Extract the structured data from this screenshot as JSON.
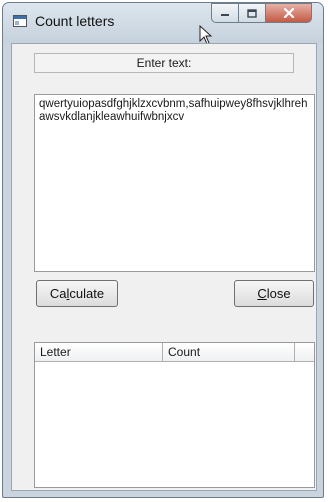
{
  "window": {
    "title": "Count letters",
    "icons": {
      "app": "app-window-icon",
      "minimize": "minimize-icon",
      "maximize": "maximize-icon",
      "close": "close-x-icon",
      "cursor": "mouse-cursor-icon"
    }
  },
  "form": {
    "prompt_label": "Enter text:",
    "text_value": "qwertyuiopasdfghjklzxcvbnm,safhuipwey8fhsvjklhrehawsvkdlanjkleawhuifwbnjxcv",
    "calculate": {
      "pre": "Ca",
      "mnemonic": "l",
      "post": "culate"
    },
    "close": {
      "pre": "",
      "mnemonic": "C",
      "post": "lose"
    }
  },
  "list": {
    "columns": [
      "Letter",
      "Count"
    ],
    "rows": []
  },
  "colors": {
    "frame": "#c9d4df",
    "client": "#f0f0f0",
    "close_button": "#c45a44"
  }
}
